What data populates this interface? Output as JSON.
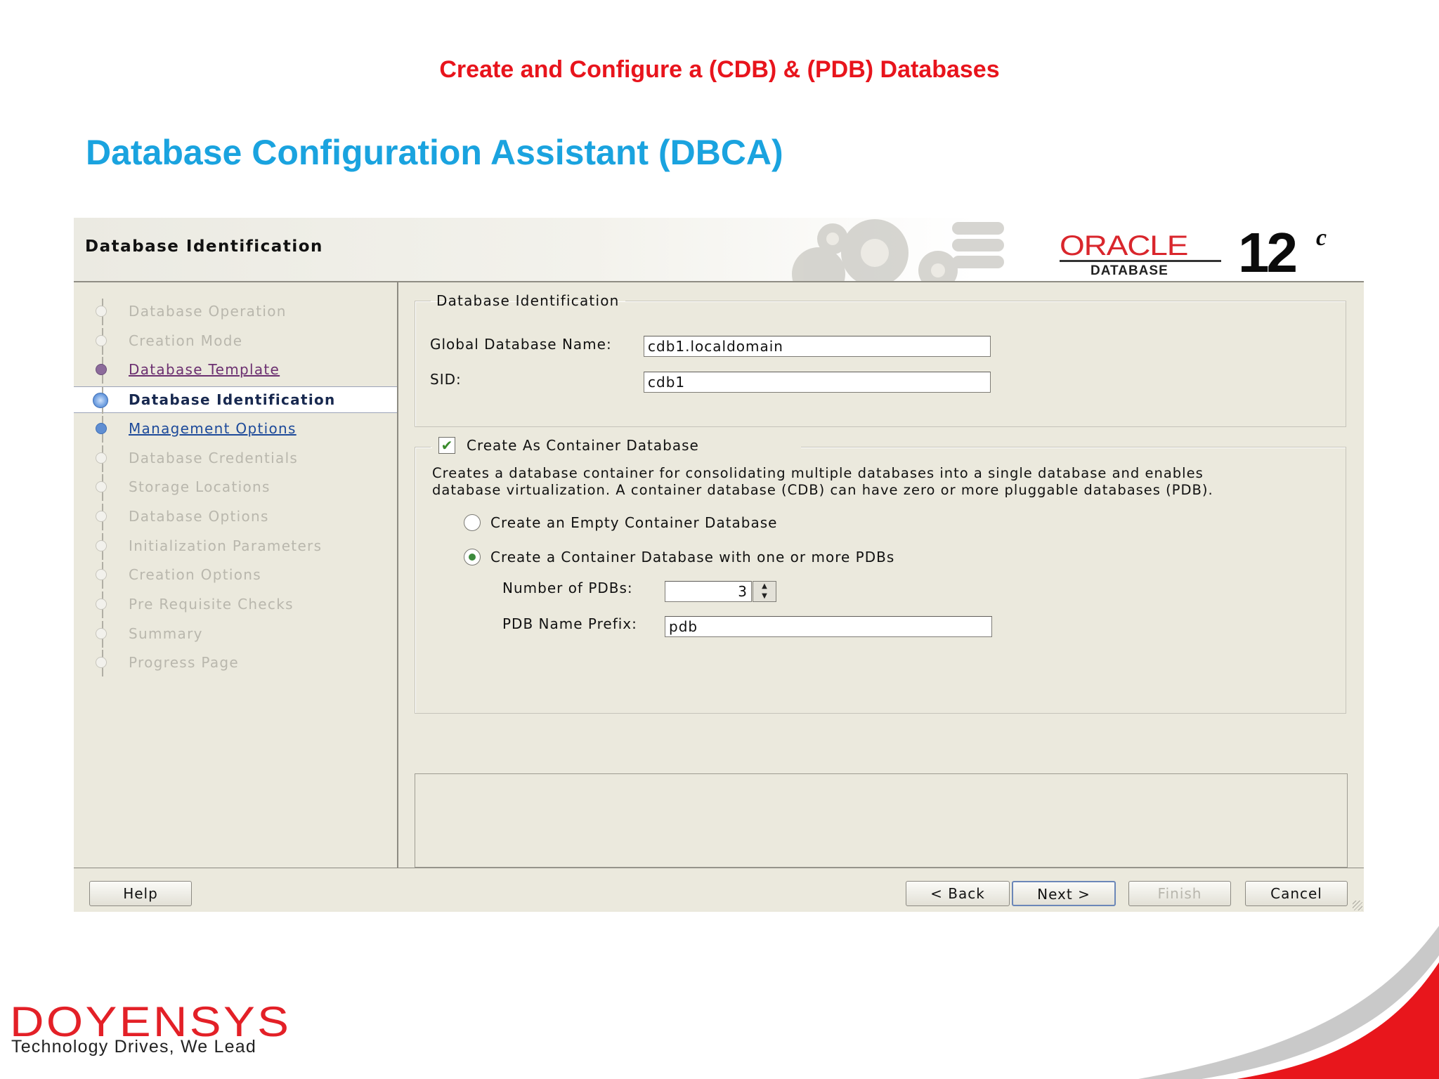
{
  "slide": {
    "top_title": "Create and Configure a (CDB) & (PDB) Databases",
    "heading": "Database Configuration Assistant (DBCA)"
  },
  "window": {
    "title": "Database Identification",
    "oracle": {
      "brand": "ORACLE",
      "product": "DATABASE",
      "version": "12",
      "version_suffix": "c"
    }
  },
  "steps": [
    {
      "label": "Database Operation",
      "state": "pending"
    },
    {
      "label": "Creation Mode",
      "state": "pending"
    },
    {
      "label": "Database Template",
      "state": "visited"
    },
    {
      "label": "Database Identification",
      "state": "current"
    },
    {
      "label": "Management Options",
      "state": "link"
    },
    {
      "label": "Database Credentials",
      "state": "pending"
    },
    {
      "label": "Storage Locations",
      "state": "pending"
    },
    {
      "label": "Database Options",
      "state": "pending"
    },
    {
      "label": "Initialization Parameters",
      "state": "pending"
    },
    {
      "label": "Creation Options",
      "state": "pending"
    },
    {
      "label": "Pre Requisite Checks",
      "state": "pending"
    },
    {
      "label": "Summary",
      "state": "pending"
    },
    {
      "label": "Progress Page",
      "state": "pending"
    }
  ],
  "identification": {
    "legend": "Database Identification",
    "global_name_label": "Global Database Name:",
    "global_name_value": "cdb1.localdomain",
    "sid_label": "SID:",
    "sid_value": "cdb1"
  },
  "container": {
    "checkbox_label": "Create As Container Database",
    "checked": true,
    "description_line1": "Creates a database container for consolidating multiple databases into a single database and enables",
    "description_line2": "database virtualization. A container database (CDB) can have zero or more pluggable databases (PDB).",
    "option_empty": "Create an Empty Container Database",
    "option_with_pdbs": "Create a Container Database with one or more PDBs",
    "selected_option": "with_pdbs",
    "num_pdbs_label": "Number of PDBs:",
    "num_pdbs_value": "3",
    "pdb_prefix_label": "PDB Name Prefix:",
    "pdb_prefix_value": "pdb"
  },
  "buttons": {
    "help": "Help",
    "back": "< Back",
    "next": "Next >",
    "finish": "Finish",
    "cancel": "Cancel"
  },
  "brand": {
    "name": "DOYENSYS",
    "tagline": "Technology Drives, We Lead"
  },
  "colors": {
    "slide_title": "#e8141c",
    "heading": "#1aa3df",
    "oracle_red": "#d9262c",
    "brand_red": "#e32027",
    "dialog_bg": "#ebe9dd"
  }
}
